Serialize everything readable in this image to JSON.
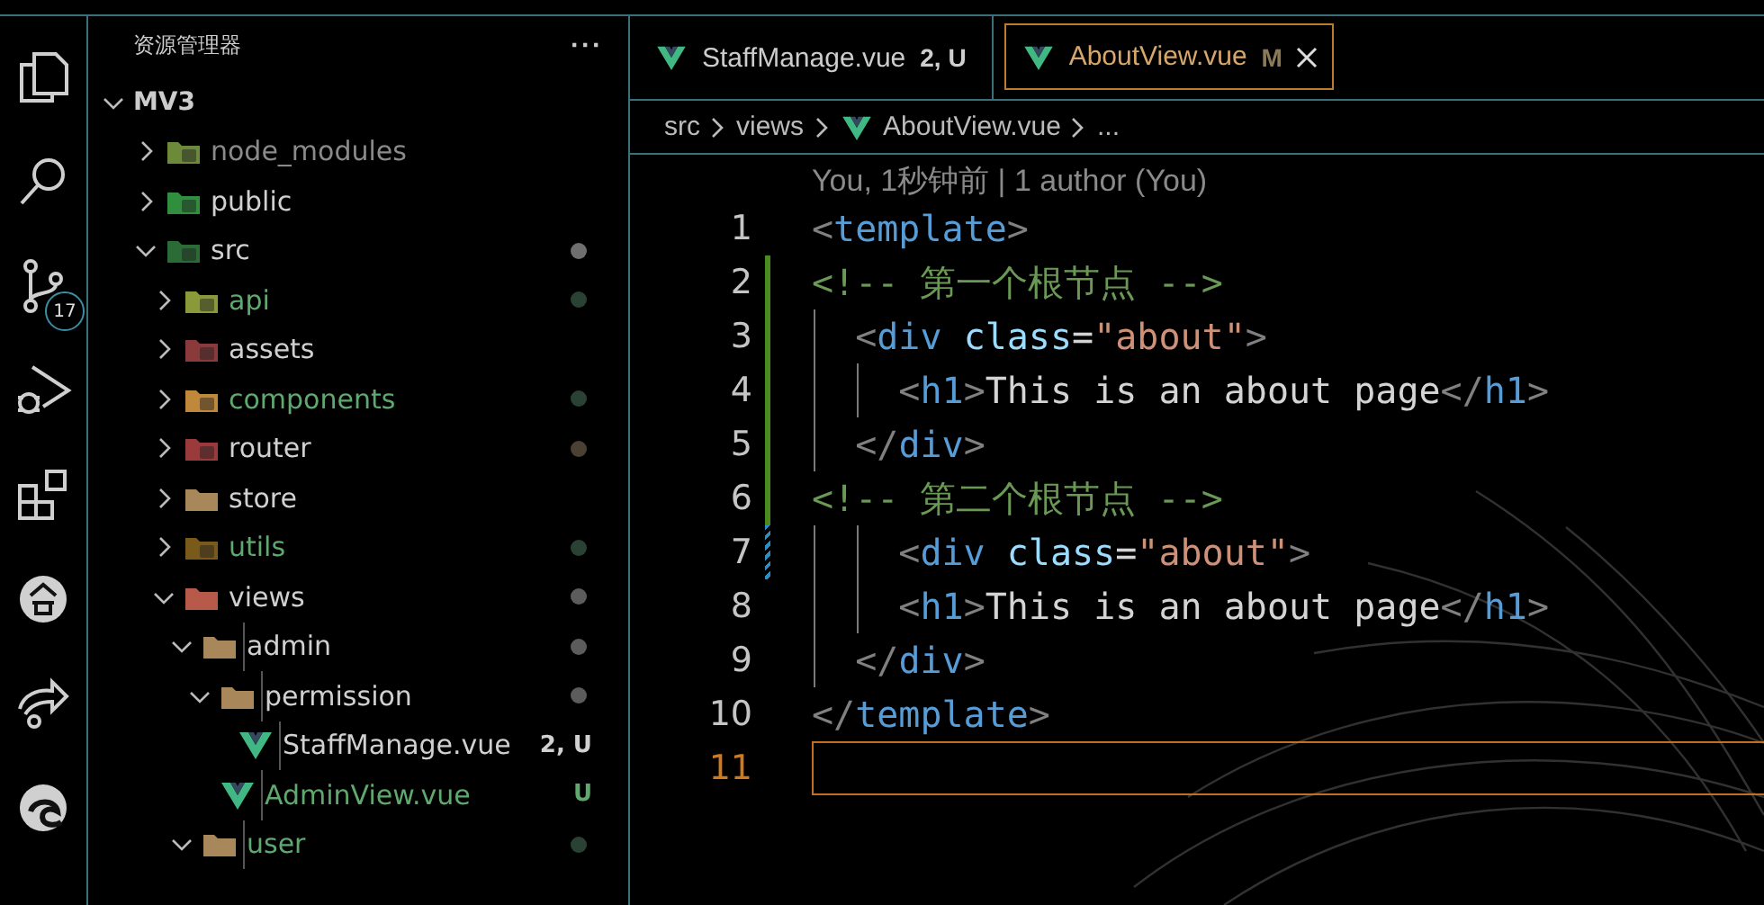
{
  "activity_bar": [
    {
      "kind": "explorer"
    },
    {
      "kind": "search"
    },
    {
      "kind": "source-control",
      "badge": "17"
    },
    {
      "kind": "run-debug"
    },
    {
      "kind": "extensions"
    },
    {
      "kind": "pavilion"
    },
    {
      "kind": "share"
    },
    {
      "kind": "browser"
    }
  ],
  "explorer": {
    "title": "资源管理器",
    "more": "···",
    "root": {
      "name": "MV3",
      "expanded": true
    },
    "items": [
      {
        "name": "node_modules",
        "kind": "folder",
        "ignored": true,
        "untracked": false,
        "expanded": false
      },
      {
        "name": "public",
        "kind": "folder",
        "ignored": false,
        "untracked": false,
        "expanded": false
      },
      {
        "name": "src",
        "kind": "folder",
        "ignored": false,
        "untracked": false,
        "expanded": true,
        "color": "#6f6f6f",
        "children": [
          {
            "name": "api",
            "kind": "folder",
            "ignored": false,
            "untracked": true,
            "expanded": false,
            "color": "#2a4233"
          },
          {
            "name": "assets",
            "kind": "folder",
            "ignored": false,
            "untracked": false,
            "expanded": false
          },
          {
            "name": "components",
            "kind": "folder",
            "ignored": false,
            "untracked": true,
            "expanded": false,
            "color": "#2a4233"
          },
          {
            "name": "router",
            "kind": "folder",
            "ignored": false,
            "untracked": false,
            "expanded": false,
            "color": "#4a4034"
          },
          {
            "name": "store",
            "kind": "folder",
            "ignored": false,
            "untracked": false,
            "expanded": false
          },
          {
            "name": "utils",
            "kind": "folder",
            "ignored": false,
            "untracked": true,
            "expanded": false,
            "color": "#2a4233"
          },
          {
            "name": "views",
            "kind": "folder",
            "ignored": false,
            "untracked": false,
            "expanded": true,
            "color": "#5c5c5c",
            "children": [
              {
                "name": "admin",
                "kind": "folder",
                "ignored": false,
                "untracked": false,
                "expanded": true,
                "color": "#5c5c5c",
                "children": [
                  {
                    "name": "permission",
                    "kind": "folder",
                    "ignored": false,
                    "untracked": false,
                    "expanded": true,
                    "color": "#5c5c5c",
                    "children": [
                      {
                        "name": "StaffManage.vue",
                        "kind": "file",
                        "ignored": false,
                        "untracked": false,
                        "badge": "2, U"
                      }
                    ]
                  },
                  {
                    "name": "AdminView.vue",
                    "kind": "file",
                    "ignored": false,
                    "untracked": true,
                    "badge": "U"
                  }
                ]
              },
              {
                "name": "user",
                "kind": "folder",
                "ignored": false,
                "untracked": true,
                "expanded": true,
                "color": "#2a4233"
              }
            ]
          }
        ]
      }
    ]
  },
  "tabs": [
    {
      "label": "StaffManage.vue",
      "badge": "2, U",
      "selected": false
    },
    {
      "label": "AboutView.vue",
      "badge": "M",
      "selected": true
    }
  ],
  "breadcrumb": [
    "src",
    "views",
    "AboutView.vue",
    "..."
  ],
  "codelens": "You, 1秒钟前 | 1 author (You)",
  "lines": [
    {
      "number": "1",
      "added": false,
      "modified": false,
      "current": false,
      "code": "<template>"
    },
    {
      "number": "2",
      "added": true,
      "modified": false,
      "current": false,
      "code": "<!-- 第一个根节点 -->"
    },
    {
      "number": "3",
      "added": true,
      "modified": false,
      "current": false,
      "code": "  <div class=\"about\">"
    },
    {
      "number": "4",
      "added": true,
      "modified": false,
      "current": false,
      "code": "    <h1>This is an about page</h1>"
    },
    {
      "number": "5",
      "added": true,
      "modified": false,
      "current": false,
      "code": "  </div>"
    },
    {
      "number": "6",
      "added": true,
      "modified": false,
      "current": false,
      "code": "<!-- 第二个根节点 -->"
    },
    {
      "number": "7",
      "added": false,
      "modified": true,
      "current": false,
      "code": "    <div class=\"about\">"
    },
    {
      "number": "8",
      "added": false,
      "modified": false,
      "current": false,
      "code": "    <h1>This is an about page</h1>"
    },
    {
      "number": "9",
      "added": false,
      "modified": false,
      "current": false,
      "code": "  </div>"
    },
    {
      "number": "10",
      "added": false,
      "modified": false,
      "current": false,
      "code": "</template>"
    },
    {
      "number": "11",
      "added": false,
      "modified": false,
      "current": true
    }
  ]
}
